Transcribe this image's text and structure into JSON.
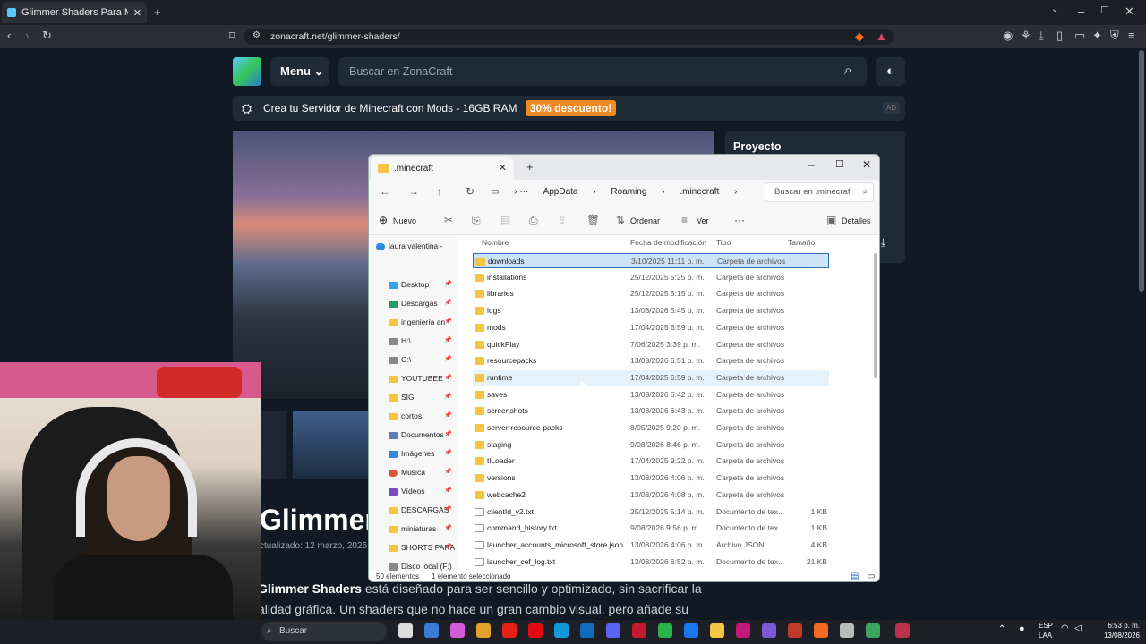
{
  "browser": {
    "tab_title": "Glimmer Shaders Para Minecraft",
    "url": "zonacraft.net/glimmer-shaders/"
  },
  "site": {
    "menu_label": "Menu",
    "search_placeholder": "Buscar en ZonaCraft",
    "promo_text": "Crea tu Servidor de Minecraft con Mods - 16GB RAM",
    "promo_badge": "30% descuento!",
    "ad_label": "AD",
    "sidebar_heading": "Proyecto",
    "title": "Glimmer",
    "updated": "ctualizado: 12 marzo, 2025",
    "para1_bold": "Glimmer Shaders",
    "para1_rest": " está diseñado para ser sencillo y optimizado, sin sacrificar la",
    "para2": "alidad gráfica. Un shaders que no hace un gran cambio visual, pero añade su"
  },
  "explorer": {
    "tab_title": ".minecraft",
    "breadcrumb": [
      "AppData",
      "Roaming",
      ".minecraft"
    ],
    "search_placeholder": "Buscar en .minecraf",
    "commands": {
      "new": "Nuevo",
      "sort": "Ordenar",
      "view": "Ver",
      "details": "Detalles"
    },
    "nav_root": "laura valentina -",
    "nav_items": [
      "Desktop",
      "Descargas",
      "ingeniería an",
      "H:\\",
      "G:\\",
      "YOUTUBEE",
      "SIG",
      "cortos",
      "Documentos",
      "Imágenes",
      "Música",
      "Vídeos",
      "DESCARGAS",
      "miniaturas",
      "SHORTS PARA S",
      "Disco local (F:)"
    ],
    "columns": {
      "name": "Nombre",
      "date": "Fecha de modificación",
      "type": "Tipo",
      "size": "Tamaño"
    },
    "files": [
      {
        "name": "downloads",
        "date": "3/10/2025 11:11 p. m.",
        "type": "Carpeta de archivos",
        "size": "",
        "kind": "folder"
      },
      {
        "name": "installations",
        "date": "25/12/2025 5:25 p. m.",
        "type": "Carpeta de archivos",
        "size": "",
        "kind": "folder"
      },
      {
        "name": "libraries",
        "date": "25/12/2025 5:15 p. m.",
        "type": "Carpeta de archivos",
        "size": "",
        "kind": "folder"
      },
      {
        "name": "logs",
        "date": "13/08/2026 5:45 p. m.",
        "type": "Carpeta de archivos",
        "size": "",
        "kind": "folder"
      },
      {
        "name": "mods",
        "date": "17/04/2025 6:59 p. m.",
        "type": "Carpeta de archivos",
        "size": "",
        "kind": "folder"
      },
      {
        "name": "quickPlay",
        "date": "7/06/2025 3:39 p. m.",
        "type": "Carpeta de archivos",
        "size": "",
        "kind": "folder"
      },
      {
        "name": "resourcepacks",
        "date": "13/08/2026 6:51 p. m.",
        "type": "Carpeta de archivos",
        "size": "",
        "kind": "folder"
      },
      {
        "name": "runtime",
        "date": "17/04/2025 6:59 p. m.",
        "type": "Carpeta de archivos",
        "size": "",
        "kind": "folder"
      },
      {
        "name": "saves",
        "date": "13/08/2026 6:42 p. m.",
        "type": "Carpeta de archivos",
        "size": "",
        "kind": "folder"
      },
      {
        "name": "screenshots",
        "date": "13/08/2026 6:43 p. m.",
        "type": "Carpeta de archivos",
        "size": "",
        "kind": "folder"
      },
      {
        "name": "server-resource-packs",
        "date": "8/05/2025 9:20 p. m.",
        "type": "Carpeta de archivos",
        "size": "",
        "kind": "folder"
      },
      {
        "name": "staging",
        "date": "9/08/2026 8:46 p. m.",
        "type": "Carpeta de archivos",
        "size": "",
        "kind": "folder"
      },
      {
        "name": "tlLoader",
        "date": "17/04/2025 9:22 p. m.",
        "type": "Carpeta de archivos",
        "size": "",
        "kind": "folder"
      },
      {
        "name": "versions",
        "date": "13/08/2026 4:06 p. m.",
        "type": "Carpeta de archivos",
        "size": "",
        "kind": "folder"
      },
      {
        "name": "webcache2",
        "date": "13/08/2026 4:08 p. m.",
        "type": "Carpeta de archivos",
        "size": "",
        "kind": "folder"
      },
      {
        "name": "clientId_v2.txt",
        "date": "25/12/2025 5:14 p. m.",
        "type": "Documento de tex...",
        "size": "1 KB",
        "kind": "file"
      },
      {
        "name": "command_history.txt",
        "date": "9/08/2026 9:56 p. m.",
        "type": "Documento de tex...",
        "size": "1 KB",
        "kind": "file"
      },
      {
        "name": "launcher_accounts_microsoft_store.json",
        "date": "13/08/2026 4:06 p. m.",
        "type": "Archivo JSON",
        "size": "4 KB",
        "kind": "file"
      },
      {
        "name": "launcher_cef_log.txt",
        "date": "13/08/2026 6:52 p. m.",
        "type": "Documento de tex...",
        "size": "21 KB",
        "kind": "file"
      }
    ],
    "status_count": "50 elementos",
    "status_selected": "1 elemento seleccionado"
  },
  "taskbar": {
    "search_placeholder": "Buscar",
    "lang": "ESP",
    "lang2": "LAA",
    "time": "6:53 p. m.",
    "date": "13/08/2026"
  },
  "colors": {
    "folder": "#f4c542",
    "selection": "#cce4f7",
    "promo_badge": "#f08a24",
    "site_bg": "#111a24"
  }
}
